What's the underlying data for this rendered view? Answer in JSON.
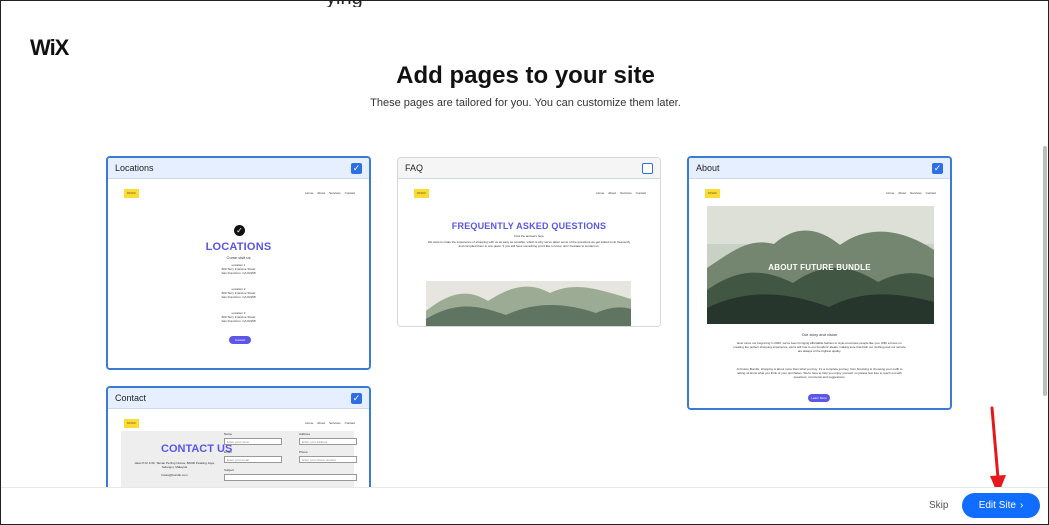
{
  "partial_top_text": "ying",
  "brand": {
    "logo": "WiX"
  },
  "header": {
    "title": "Add pages to your site",
    "subtitle": "These pages are tailored for you. You can customize them later."
  },
  "mini_nav": {
    "logo": "MISDF",
    "links": [
      "Home",
      "About",
      "Services",
      "Contact"
    ]
  },
  "cards": [
    {
      "name": "Locations",
      "selected": true,
      "preview": {
        "heading": "LOCATIONS",
        "subheading": "Come visit us",
        "locations": [
          [
            "Location 1",
            "500 Terry Francine Street",
            "San Francisco, CA 94158"
          ],
          [
            "Location 2",
            "500 Terry Francine Street",
            "San Francisco, CA 94158"
          ],
          [
            "Location 3",
            "500 Terry Francine Street",
            "San Francisco, CA 94158"
          ]
        ],
        "button": "Contact"
      }
    },
    {
      "name": "FAQ",
      "selected": false,
      "preview": {
        "heading": "FREQUENTLY ASKED QUESTIONS",
        "subheading": "Find the answers here",
        "body": "We want to make the experience of shopping with us as easy as possible, which is why we've taken some of the questions we get asked most frequently and compiled them in one place. If you still have something you'd like to know, don't hesitate to contact us."
      }
    },
    {
      "name": "About",
      "selected": true,
      "preview": {
        "hero_title": "ABOUT FUTURE BUNDLE",
        "section_title": "Our story and vision",
        "body_1": "Ever since our beginning in 2020, we've been bringing affordable fashion to style-conscious people like you. With a focus on creating the perfect shopping experience, we're still true to our founders' ideals, making sure that both our clothing and our service are always of the highest quality.",
        "body_2": "At Future Bundle, shopping is about more than what you buy; it's a complete journey, from browsing to choosing your outfit to letting us know what you think of your purchases. We're here to help you enjoy yourself, so please feel free to reach out with questions, comments and suggestions.",
        "button": "Learn More"
      }
    },
    {
      "name": "Contact",
      "selected": true,
      "preview": {
        "heading": "CONTACT US",
        "address": "Jalan PJU 1/39, Taman Perling Utama, 80000 Petaling Jaya, Selangor, Malaysia",
        "email": "future@bundle.com",
        "fields": [
          {
            "label": "Name",
            "placeholder": "Enter your name"
          },
          {
            "label": "Address",
            "placeholder": "Enter your address"
          },
          {
            "label": "Email",
            "placeholder": "Enter your email"
          },
          {
            "label": "Phone",
            "placeholder": "Enter your phone number"
          },
          {
            "label": "Subject",
            "placeholder": ""
          }
        ]
      }
    }
  ],
  "footer": {
    "skip": "Skip",
    "edit_site": "Edit Site",
    "chevron": "›"
  },
  "annotation": {
    "color": "#e4191d"
  },
  "colors": {
    "accent": "#116dff",
    "checkbox": "#2f6fe4",
    "preview_heading": "#5a56e6"
  },
  "icons": [
    "checkmark-icon",
    "chevron-right-icon",
    "red-arrow-icon"
  ]
}
